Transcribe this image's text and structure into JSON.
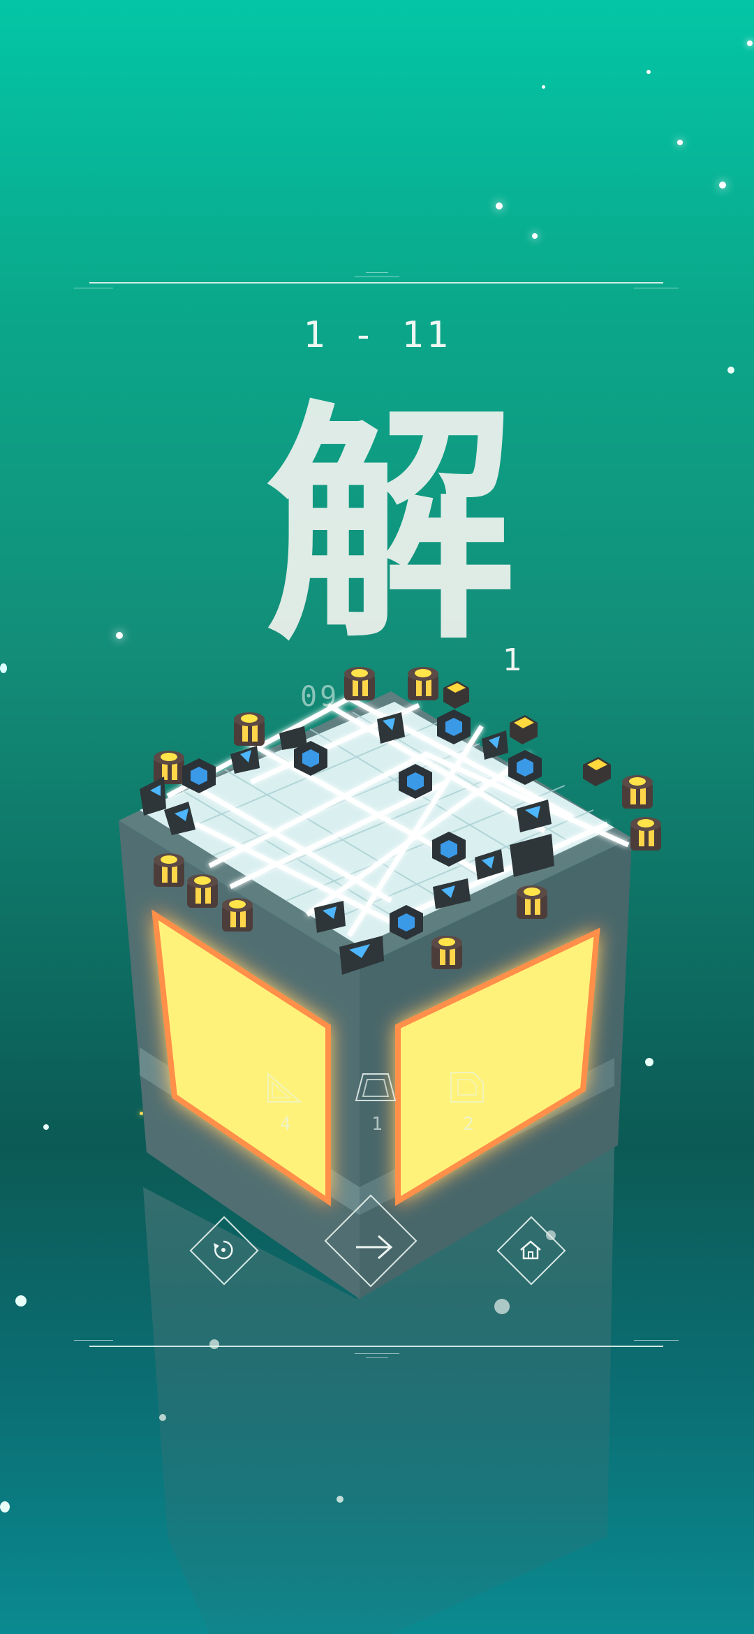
{
  "level": {
    "label": "1 - 11"
  },
  "result": {
    "character": "解",
    "step_count": "1",
    "moves_display": "09 "
  },
  "pieces": [
    {
      "icon": "triangle-piece-icon",
      "count": "4"
    },
    {
      "icon": "trapezoid-piece-icon",
      "count": "1"
    },
    {
      "icon": "pentagon-piece-icon",
      "count": "2"
    }
  ],
  "controls": {
    "restart_icon": "restart-icon",
    "next_icon": "next-arrow-icon",
    "home_icon": "home-icon"
  },
  "colors": {
    "background_top": "#03c6a6",
    "background_bottom": "#0a8a90",
    "glow_yellow": "#fff27a",
    "tile_cyan": "#dff6f6",
    "piece_blue": "#2f8fe0"
  }
}
